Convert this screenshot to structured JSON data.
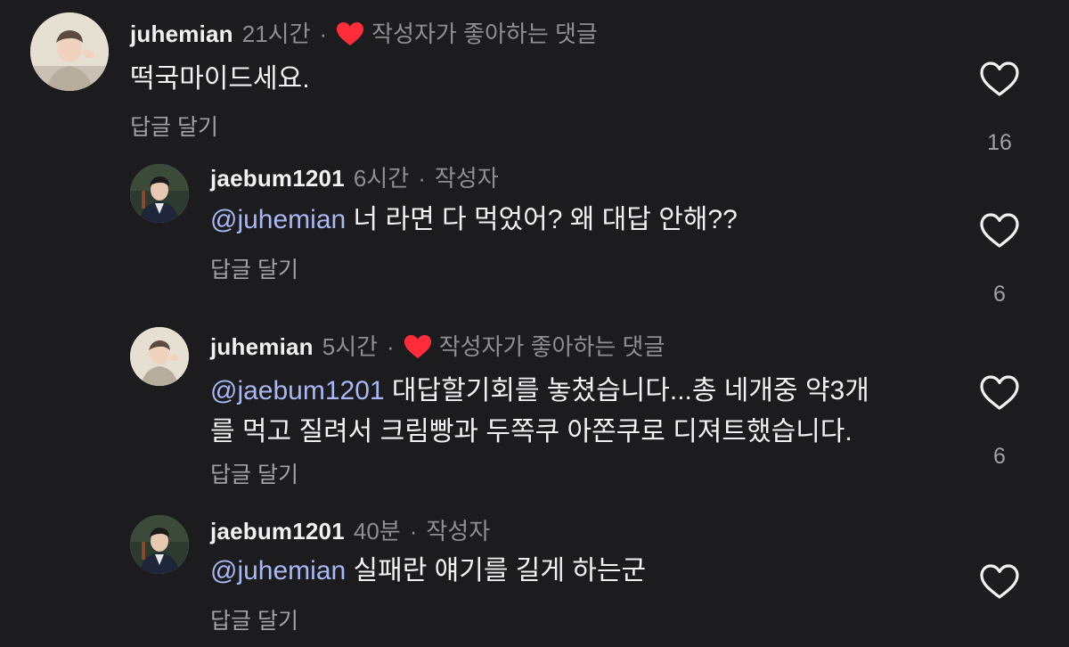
{
  "comments": [
    {
      "username": "juhemian",
      "time": "21시간",
      "separator": "·",
      "liked_by_author_label": "작성자가 좋아하는 댓글",
      "text": "떡국마이드세요.",
      "reply_label": "답글 달기",
      "like_count": "16"
    },
    {
      "username": "jaebum1201",
      "time": "6시간",
      "separator": "·",
      "author_label": "작성자",
      "mention": "@juhemian",
      "text": " 너 라면 다 먹었어? 왜 대답 안해??",
      "reply_label": "답글 달기",
      "like_count": "6"
    },
    {
      "username": "juhemian",
      "time": "5시간",
      "separator": "·",
      "liked_by_author_label": "작성자가 좋아하는 댓글",
      "mention": "@jaebum1201",
      "text_line1": " 대답할기회를 놓쳤습니다...총 네개중 약3개",
      "text_line2": "를 먹고 질려서 크림빵과 두쪽쿠 아쫀쿠로 디져트했습니다.",
      "reply_label": "답글 달기",
      "like_count": "6"
    },
    {
      "username": "jaebum1201",
      "time": "40분",
      "separator": "·",
      "author_label": "작성자",
      "mention": "@juhemian",
      "text": " 실패란 얘기를 길게 하는군",
      "reply_label": "답글 달기"
    }
  ],
  "colors": {
    "background": "#1c1c1e",
    "mention": "#a9b8f5",
    "heart_red": "#ff2d3a",
    "muted": "#8e8e93"
  },
  "icons": {
    "liked_marker": "heart-filled-icon",
    "like_button": "heart-outline-icon"
  }
}
